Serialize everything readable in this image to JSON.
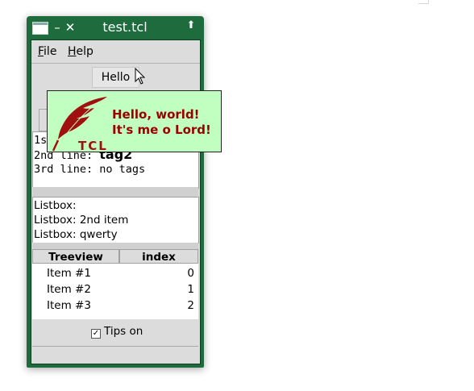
{
  "window": {
    "title": "test.tcl",
    "title_bar_color": "#1e6b3e"
  },
  "titlebar_buttons": {
    "minimize": "–",
    "close": "✕",
    "shade": "⬆"
  },
  "menubar": {
    "file_label_ul": "F",
    "file_label_rest": "ile",
    "help_label_ul": "H",
    "help_label_rest": "elp"
  },
  "hello_button": {
    "label": "Hello"
  },
  "text_widget": {
    "line1": "1st",
    "line2_prefix": "2nd line: ",
    "line2_tag": "tag2",
    "line3": "3rd line: no tags"
  },
  "listbox": {
    "items": [
      "Listbox:",
      "Listbox: 2nd item",
      "Listbox: qwerty"
    ]
  },
  "treeview": {
    "columns": [
      "Treeview",
      "index"
    ],
    "rows": [
      {
        "name": "Item #1",
        "index": "0"
      },
      {
        "name": "Item #2",
        "index": "1"
      },
      {
        "name": "Item #3",
        "index": "2"
      }
    ]
  },
  "tips_checkbox": {
    "label": "Tips on",
    "checked": true,
    "mark": "✓"
  },
  "tooltip": {
    "line1": "Hello, world!",
    "line2": "It's me o Lord!",
    "logo_text": "TCL",
    "background": "#c1ffc1",
    "text_color": "#9b0000"
  }
}
